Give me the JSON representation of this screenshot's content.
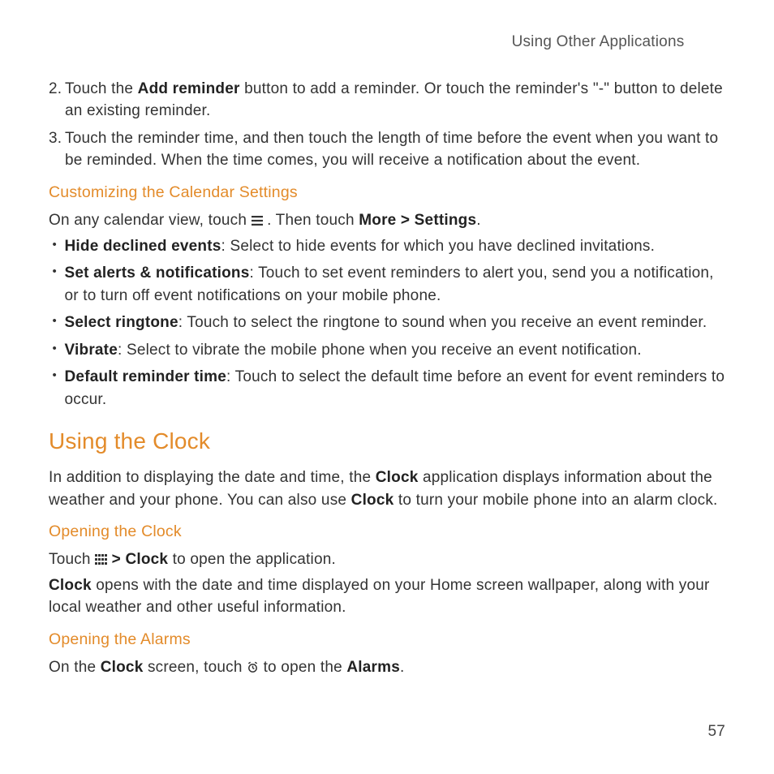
{
  "header": {
    "title": "Using Other Applications"
  },
  "steps": {
    "two": {
      "num": "2.",
      "pre": "Touch the ",
      "bold": "Add reminder",
      "post": " button to add a reminder. Or touch the reminder's \"-\" button to delete an existing reminder."
    },
    "three": {
      "num": "3.",
      "text": "Touch the reminder time, and then touch the length of time before the event when you want to be reminded. When the time comes, you will receive a notification about the event."
    }
  },
  "custSettings": {
    "heading": "Customizing the Calendar Settings",
    "intro_pre": "On any calendar view, touch ",
    "intro_mid": ". Then touch ",
    "intro_bold": "More > Settings",
    "intro_end": "."
  },
  "bullets": {
    "hide": {
      "bold": "Hide declined events",
      "rest": ": Select to hide events for which you have declined invitations."
    },
    "alerts": {
      "bold": "Set alerts & notifications",
      "rest": ": Touch to set event reminders to alert you, send you a notification, or to turn off event notifications on your mobile phone."
    },
    "ringtone": {
      "bold": "Select ringtone",
      "rest": ": Touch to select the ringtone to sound when you receive an event reminder."
    },
    "vibrate": {
      "bold": "Vibrate",
      "rest": ": Select to vibrate the mobile phone when you receive an event notification."
    },
    "default": {
      "bold": "Default reminder time",
      "rest": ": Touch to select the default time before an event for event reminders to occur."
    }
  },
  "clock": {
    "heading": "Using the Clock",
    "intro_pre": "In addition to displaying the date and time, the ",
    "intro_b1": "Clock",
    "intro_mid": " application displays information about the weather and your phone. You can also use ",
    "intro_b2": "Clock",
    "intro_end": " to turn your mobile phone into an alarm clock."
  },
  "openClock": {
    "heading": "Opening the Clock",
    "line1_pre": "Touch ",
    "line1_bold": " > Clock",
    "line1_post": " to open the application.",
    "line2_b": "Clock",
    "line2_rest": " opens with the date and time displayed on your Home screen wallpaper, along with your local weather and other useful information."
  },
  "openAlarms": {
    "heading": "Opening the Alarms",
    "pre": "On the ",
    "b1": "Clock",
    "mid": " screen, touch ",
    "mid2": " to open the ",
    "b2": "Alarms",
    "end": "."
  },
  "pageNumber": "57"
}
